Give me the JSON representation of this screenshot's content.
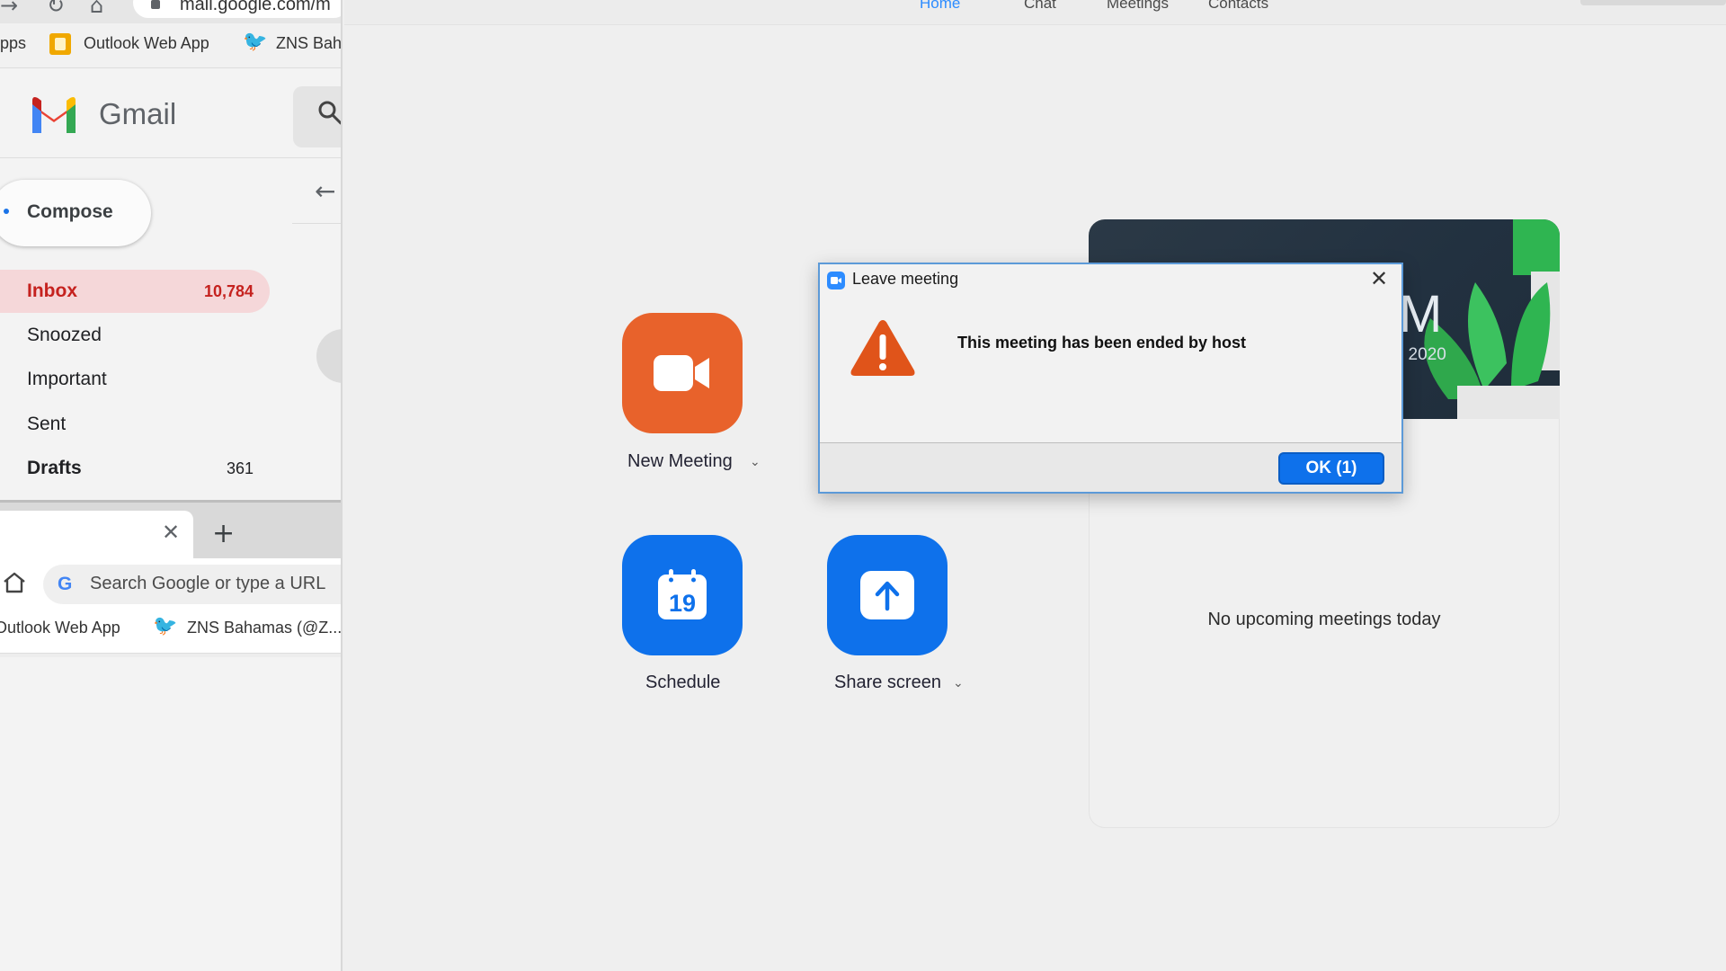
{
  "browser": {
    "url": "mail.google.com/m",
    "bookmarks": {
      "apps": "pps",
      "outlook": "Outlook Web App",
      "zns": "ZNS Baha"
    }
  },
  "gmail": {
    "app_name": "Gmail",
    "compose_label": "Compose",
    "nav": [
      {
        "label": "Inbox",
        "count": "10,784"
      },
      {
        "label": "Snoozed",
        "count": ""
      },
      {
        "label": "Important",
        "count": ""
      },
      {
        "label": "Sent",
        "count": ""
      },
      {
        "label": "Drafts",
        "count": "361"
      }
    ]
  },
  "second_browser": {
    "omnibox_placeholder": "Search Google or type a URL",
    "bookmarks": {
      "outlook": "Outlook Web App",
      "zns": "ZNS Bahamas (@Z..."
    }
  },
  "zoom": {
    "tabs": [
      "Home",
      "Chat",
      "Meetings",
      "Contacts"
    ],
    "actions": {
      "new_meeting": "New Meeting",
      "schedule": "Schedule",
      "schedule_day": "19",
      "share_screen": "Share screen"
    },
    "banner": {
      "time": "M",
      "date": ", 2020"
    },
    "upcoming_empty": "No upcoming meetings today"
  },
  "dialog": {
    "title": "Leave meeting",
    "message": "This meeting has been ended by host",
    "ok_label": "OK (1)"
  },
  "colors": {
    "zoom_blue": "#0e71eb",
    "zoom_orange": "#e8622b",
    "gmail_red": "#c5221f",
    "warning_orange": "#e0541a"
  },
  "icons": {
    "dialog_icon": "warning-triangle-icon",
    "new_meeting_icon": "video-camera-icon",
    "schedule_icon": "calendar-icon",
    "share_icon": "upload-arrow-icon"
  }
}
